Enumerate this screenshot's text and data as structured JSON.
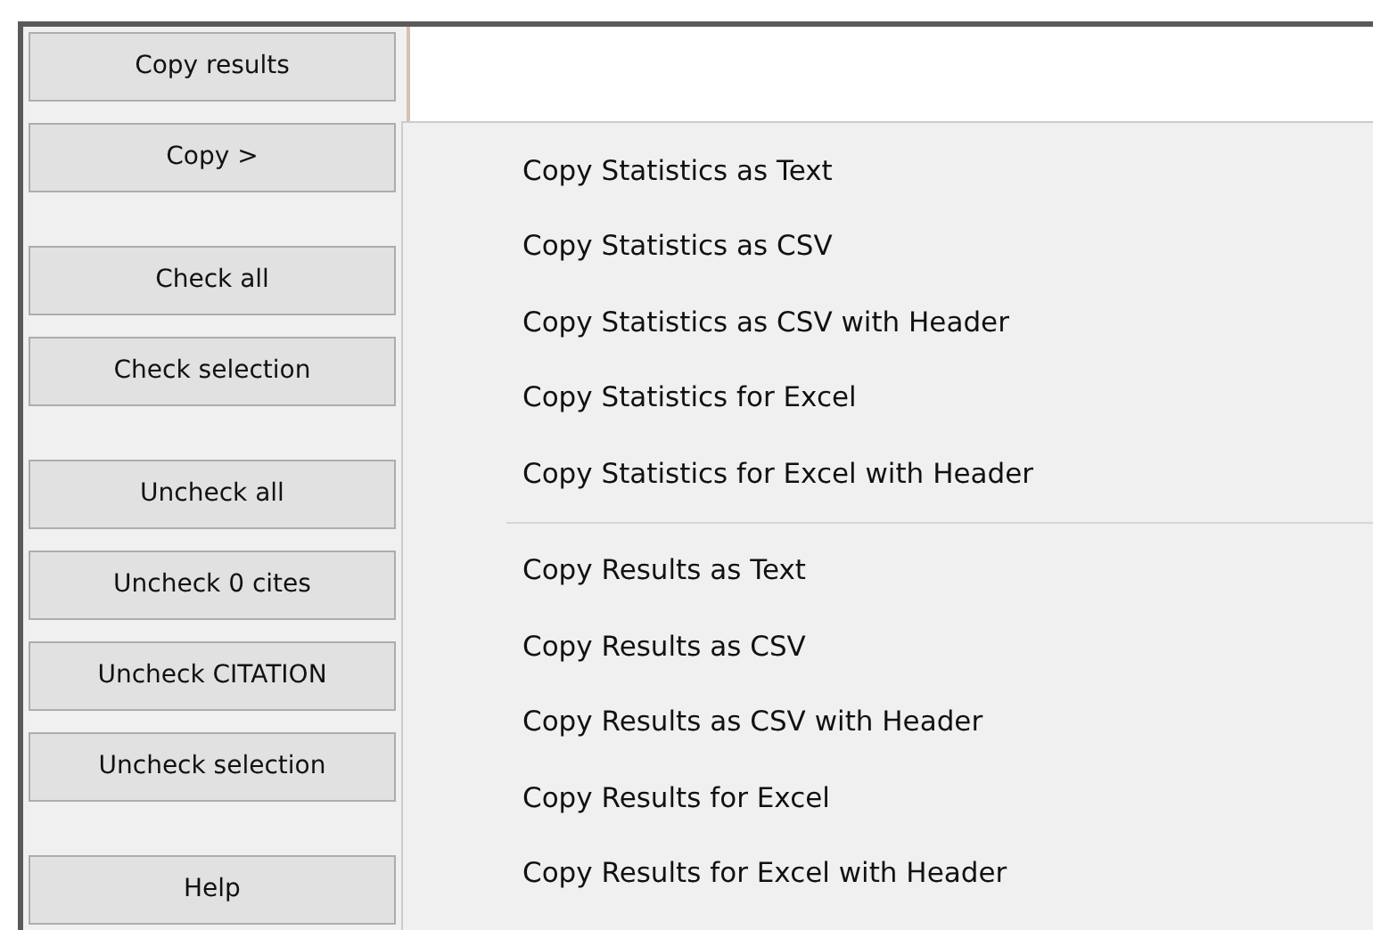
{
  "button_groups": [
    {
      "buttons": [
        "Copy results",
        "Copy >"
      ]
    },
    {
      "buttons": [
        "Check all",
        "Check selection"
      ]
    },
    {
      "buttons": [
        "Uncheck all",
        "Uncheck 0 cites",
        "Uncheck CITATION",
        "Uncheck selection"
      ]
    },
    {
      "buttons": [
        "Help"
      ]
    }
  ],
  "context_menu": {
    "sections": [
      {
        "items": [
          "Copy Statistics as Text",
          "Copy Statistics as CSV",
          "Copy Statistics as CSV with Header",
          "Copy Statistics for Excel",
          "Copy Statistics for Excel with Header"
        ]
      },
      {
        "items": [
          "Copy Results as Text",
          "Copy Results as CSV",
          "Copy Results as CSV with Header",
          "Copy Results for Excel",
          "Copy Results for Excel with Header"
        ]
      }
    ]
  }
}
